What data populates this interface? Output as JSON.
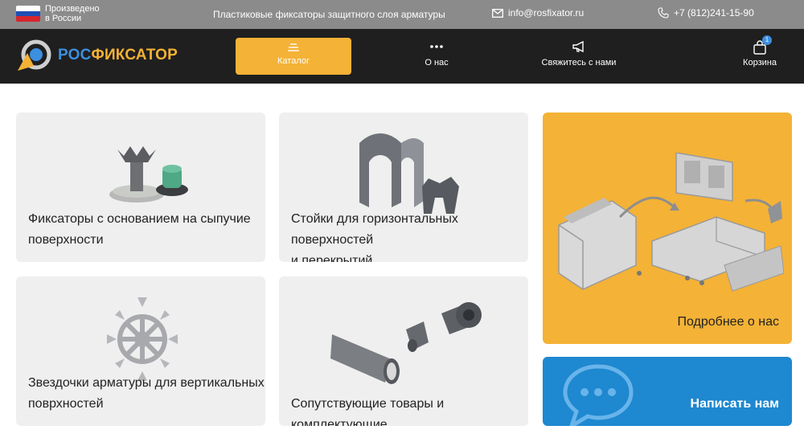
{
  "topbar": {
    "made_line1": "Произведено",
    "made_line2": "в России",
    "tagline": "Пластиковые фиксаторы защитного слоя арматуры",
    "email": "info@rosfixator.ru",
    "phone": "+7 (812)241-15-90",
    "flag_colors": [
      "#ffffff",
      "#1f4fb4",
      "#d6262d"
    ]
  },
  "nav": {
    "logo_part1": "РОС",
    "logo_part2": "ФИКСАТОР",
    "catalog": "Каталог",
    "about": "О нас",
    "contact": "Свяжитесь с нами",
    "cart": "Корзина",
    "cart_count": "1"
  },
  "cards": {
    "c1_line1": "Фиксаторы с основанием на сыпучие",
    "c1_line2": "поверхности",
    "c2_line1": "Стойки для горизонтальных поверхностей",
    "c2_line2": "и перекрытий",
    "c3_line1": "Звездочки арматуры для вертикальных",
    "c3_line2": "поврхностей",
    "c4_line1": "Сопутствующие товары и комплектующие",
    "about_more": "Подробнее о нас",
    "write_us": "Написать нам"
  },
  "colors": {
    "accent": "#f4b236",
    "brand_blue": "#3d8fe0",
    "write_bg": "#1e88d0"
  }
}
